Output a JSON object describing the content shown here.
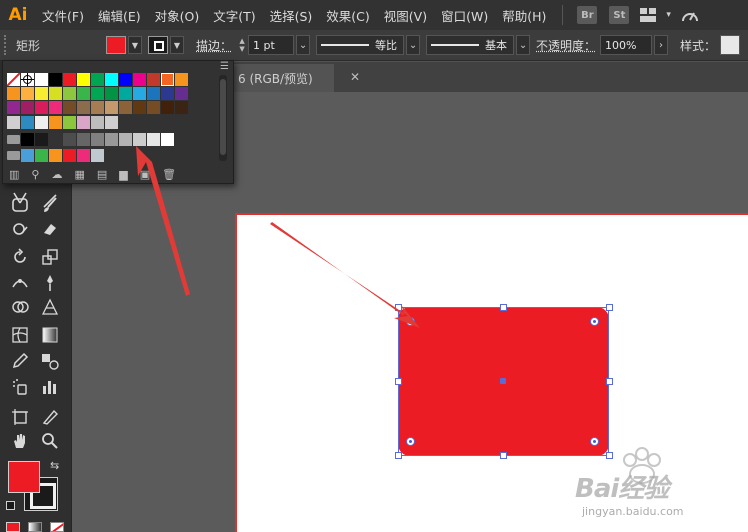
{
  "app": {
    "logo_text": "Ai",
    "menus": [
      "文件(F)",
      "编辑(E)",
      "对象(O)",
      "文字(T)",
      "选择(S)",
      "效果(C)",
      "视图(V)",
      "窗口(W)",
      "帮助(H)"
    ],
    "bridge_label": "Br",
    "stock_label": "St"
  },
  "control_bar": {
    "shape_label": "矩形",
    "stroke_label": "描边：",
    "stroke_value": "1 pt",
    "profile_label": "等比",
    "brush_label": "基本",
    "opacity_label": "不透明度：",
    "opacity_value": "100%",
    "style_label": "样式："
  },
  "document": {
    "tab_label": "6 (RGB/预览)",
    "close_glyph": "✕"
  },
  "swatches": {
    "row1": [
      "none",
      "registration",
      "#ffffff",
      "#000000",
      "#ed1c24",
      "#ffff00",
      "#00a651",
      "#00ffff",
      "#0000ff",
      "#ec008c",
      "#c0392b",
      "#f26522",
      "#f7941d"
    ],
    "row2": [
      "#f7941d",
      "#fbb040",
      "#f9ed32",
      "#d7df23",
      "#8dc63f",
      "#39b54a",
      "#00a651",
      "#009444",
      "#00a99d",
      "#27aae1",
      "#1c75bc",
      "#2b3990",
      "#662d91"
    ],
    "row3": [
      "#92278f",
      "#9e1f63",
      "#da1c5c",
      "#ee2a7b",
      "#754c29",
      "#8b6d4e",
      "#a67c52",
      "#c49a6c",
      "#8c6239",
      "#603913",
      "#754c24",
      "#42210b",
      "#3c2415"
    ],
    "row4": [
      "#d0d0d0",
      "#2e8bc0",
      "#eeeeee",
      "#f7941d",
      "#8cc63f",
      "#d9a6c8",
      "#bdbdbd",
      "#cfcfcf"
    ],
    "row5": [
      "#000000",
      "#1a1a1a",
      "#333333",
      "#4d4d4d",
      "#666666",
      "#808080",
      "#999999",
      "#b3b3b3",
      "#cccccc",
      "#e6e6e6",
      "#ffffff"
    ],
    "row6": [
      "#4a9fd8",
      "#39b54a",
      "#f7941d",
      "#ed1c24",
      "#ee2a7b",
      "#c0c8d0"
    ]
  },
  "colors": {
    "fill": "#ed1c24",
    "selection": "#5a6cd8",
    "artboard_border": "#e0302e"
  },
  "watermark": {
    "brand": "Bai经验",
    "url": "jingyan.baidu.com"
  }
}
